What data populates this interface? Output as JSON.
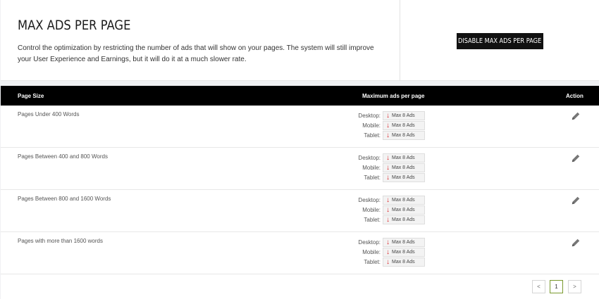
{
  "header": {
    "title": "MAX ADS PER PAGE",
    "description": "Control the optimization by restricting the number of ads that will show on your pages. The system will still improve your User Experience and Earnings, but it will do it at a much slower rate.",
    "disable_button": "DISABLE MAX ADS PER PAGE"
  },
  "table": {
    "columns": [
      "Page Size",
      "Maximum ads per page",
      "Action"
    ],
    "rows": [
      {
        "label": "Pages Under 400 Words",
        "devices": [
          {
            "name": "Desktop:",
            "value": "Max 8 Ads"
          },
          {
            "name": "Mobile:",
            "value": "Max 8 Ads"
          },
          {
            "name": "Tablet:",
            "value": "Max 8 Ads"
          }
        ]
      },
      {
        "label": "Pages Between 400 and 800 Words",
        "devices": [
          {
            "name": "Desktop:",
            "value": "Max 8 Ads"
          },
          {
            "name": "Mobile:",
            "value": "Max 8 Ads"
          },
          {
            "name": "Tablet:",
            "value": "Max 8 Ads"
          }
        ]
      },
      {
        "label": "Pages Between 800 and 1600 Words",
        "devices": [
          {
            "name": "Desktop:",
            "value": "Max 8 Ads"
          },
          {
            "name": "Mobile:",
            "value": "Max 8 Ads"
          },
          {
            "name": "Tablet:",
            "value": "Max 8 Ads"
          }
        ]
      },
      {
        "label": "Pages with more than 1600 words",
        "devices": [
          {
            "name": "Desktop:",
            "value": "Max 8 Ads"
          },
          {
            "name": "Mobile:",
            "value": "Max 8 Ads"
          },
          {
            "name": "Tablet:",
            "value": "Max 8 Ads"
          }
        ]
      }
    ]
  },
  "pagination": {
    "prev": "<",
    "current": "1",
    "next": ">"
  },
  "icons": {
    "badge_icon": "arrow-down-icon",
    "action_icon": "pencil-icon"
  },
  "colors": {
    "arrow": "#d9262b",
    "header_bg": "#000000",
    "active_page_border": "#7a9a2e"
  }
}
